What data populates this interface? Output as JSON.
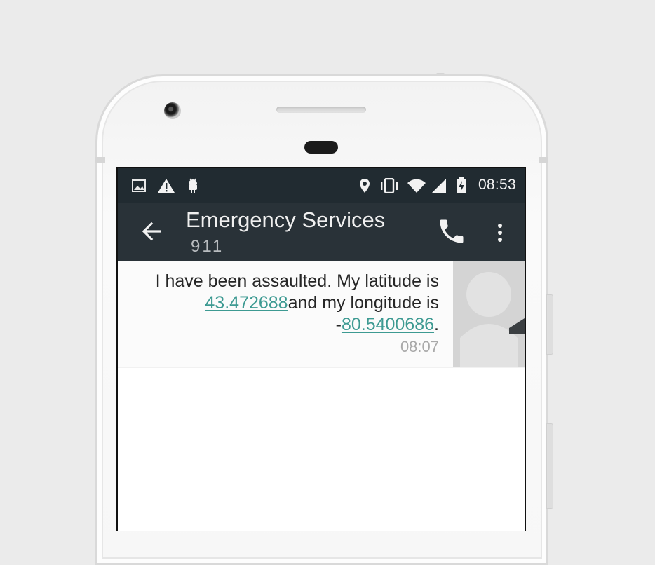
{
  "status_bar": {
    "time": "08:53",
    "left_icons": [
      "image-icon",
      "warning-icon",
      "android-icon"
    ],
    "right_icons": [
      "location-icon",
      "vibrate-icon",
      "wifi-icon",
      "signal-icon",
      "battery-charging-icon"
    ]
  },
  "app_bar": {
    "title": "Emergency Services",
    "subtitle": "911",
    "background": "#293238"
  },
  "conversation": {
    "messages": [
      {
        "text_before": "I have been assaulted. My latitude is ",
        "latitude_link": "43.472688",
        "text_middle": "and my longitude is -",
        "longitude_link": "80.5400686",
        "text_after": ".",
        "time": "08:07"
      }
    ],
    "link_color": "#3d9a92"
  }
}
